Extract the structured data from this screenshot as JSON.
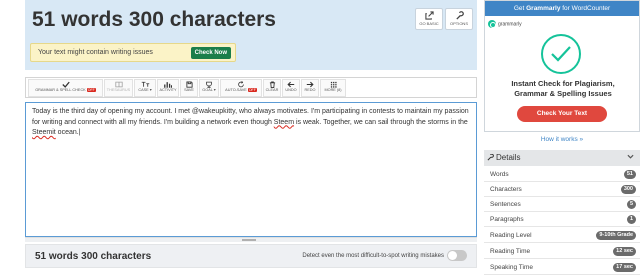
{
  "header": {
    "title": "51 words 300 characters",
    "go_basic_label": "GO BASIC",
    "options_label": "OPTIONS"
  },
  "notice": {
    "text": "Your text might contain writing issues",
    "button_label": "Check Now"
  },
  "toolbar": {
    "items": [
      {
        "label": "GRAMMAR & SPELL CHECK",
        "badge": "OFF",
        "icon": "check-icon"
      },
      {
        "label": "THESAURUS",
        "icon": "book-icon"
      },
      {
        "label": "CASE",
        "icon": "text-case-icon"
      },
      {
        "label": "ACTIVITY",
        "icon": "bar-chart-icon"
      },
      {
        "label": "SAVE",
        "icon": "save-icon"
      },
      {
        "label": "GOAL",
        "icon": "trophy-icon"
      },
      {
        "label": "AUTO-SAVE",
        "badge": "OFF",
        "icon": "refresh-icon"
      },
      {
        "label": "CLEAR",
        "icon": "trash-icon"
      },
      {
        "label": "UNDO",
        "icon": "arrow-left-icon"
      },
      {
        "label": "REDO",
        "icon": "arrow-right-icon"
      },
      {
        "label": "MORE (8)",
        "icon": "grid-icon"
      }
    ]
  },
  "editor": {
    "text_part1": "Today is the third day of opening  my  account. I met @wakeupkitty, who always motivates. I'm participating in contests to maintain my passion for writing and connect with all my friends. I'm building a network even though ",
    "misspelled1": "Steem",
    "text_part2": " is weak. Together, we can sail through the storms in the ",
    "misspelled2": "Steemit",
    "text_part3": " ocean."
  },
  "bottom": {
    "count_text": "51 words 300 characters",
    "detect_label": "Detect even the most difficult-to-spot writing mistakes",
    "toggle_on": false
  },
  "ad": {
    "header_pre": "Get ",
    "header_brand": "Grammarly",
    "header_post": " for WordCounter",
    "logo_text": "grammarly",
    "title_line1": "Instant Check for Plagiarism,",
    "title_line2": "Grammar & Spelling Issues",
    "button_label": "Check Your Text",
    "brand_color": "#15c39a",
    "button_color": "#e0483e"
  },
  "how_link": "How it works »",
  "details": {
    "title": "Details",
    "rows": [
      {
        "label": "Words",
        "value": "51"
      },
      {
        "label": "Characters",
        "value": "300"
      },
      {
        "label": "Sentences",
        "value": "5"
      },
      {
        "label": "Paragraphs",
        "value": "1"
      },
      {
        "label": "Reading Level",
        "value": "9-10th Grade"
      },
      {
        "label": "Reading Time",
        "value": "12 sec"
      },
      {
        "label": "Speaking Time",
        "value": "17 sec"
      }
    ]
  }
}
